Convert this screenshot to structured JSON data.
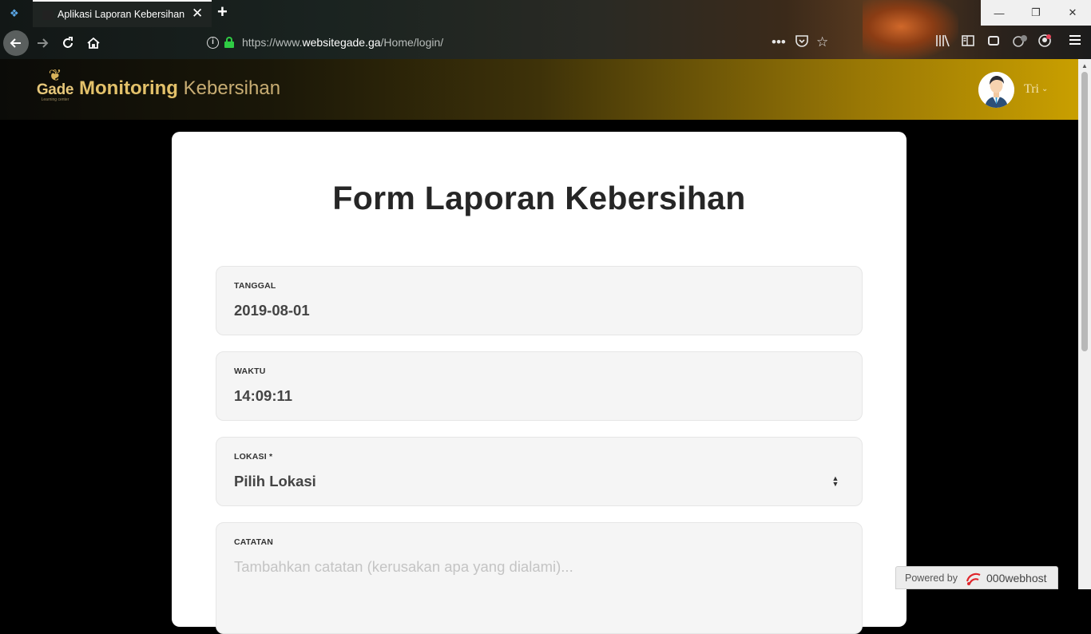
{
  "browser": {
    "tab_title": "Aplikasi Laporan Kebersihan",
    "url_prefix": "https://www.",
    "url_domain": "websitegade.ga",
    "url_path": "/Home/login/"
  },
  "header": {
    "logo_text": "Gade",
    "logo_subtext": "Learning center",
    "brand_strong": "Monitoring",
    "brand_light": "Kebersihan",
    "user_name": "Tri"
  },
  "form": {
    "title": "Form Laporan Kebersihan",
    "fields": [
      {
        "label": "TANGGAL",
        "value": "2019-08-01"
      },
      {
        "label": "WAKTU",
        "value": "14:09:11"
      },
      {
        "label": "LOKASI *",
        "value": "Pilih Lokasi"
      },
      {
        "label": "CATATAN",
        "placeholder": "Tambahkan catatan (kerusakan apa yang dialami)..."
      }
    ]
  },
  "footer_badge": {
    "powered_by": "Powered by",
    "host": "000webhost"
  },
  "colors": {
    "accent_gold": "#c99f00",
    "secure_green": "#2fcc44",
    "card_bg": "#ffffff"
  }
}
